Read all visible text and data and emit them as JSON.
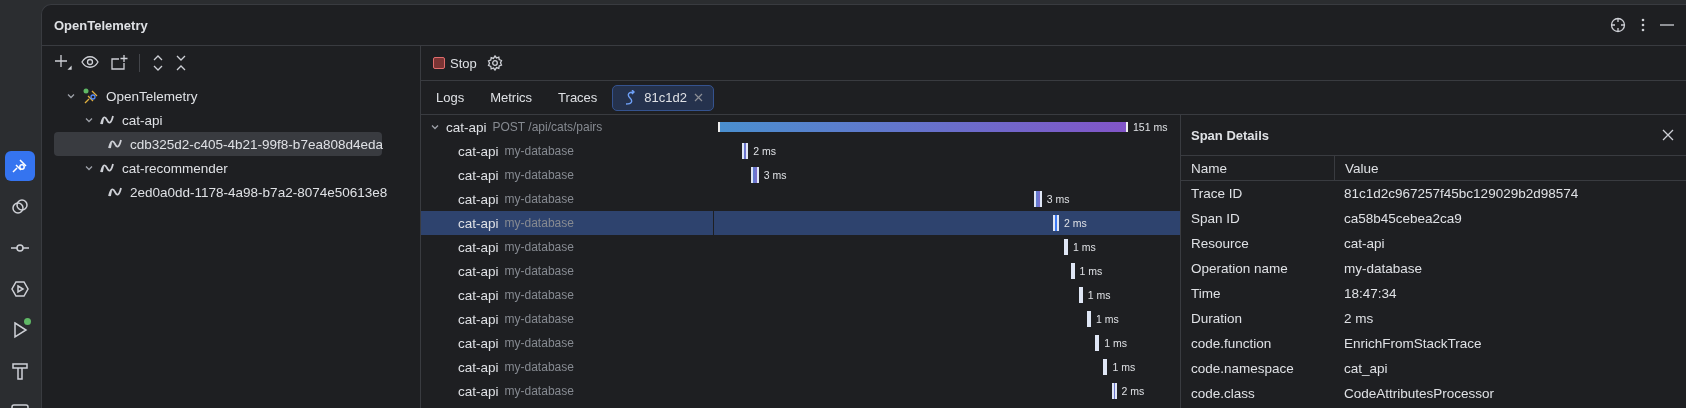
{
  "tool_strip": [
    {
      "kind": "telemetry",
      "selected": true
    },
    {
      "kind": "services",
      "selected": false
    },
    {
      "kind": "commit",
      "selected": false
    },
    {
      "kind": "services-run",
      "selected": false
    },
    {
      "kind": "run",
      "selected": false,
      "badge": true
    },
    {
      "kind": "build",
      "selected": false
    },
    {
      "kind": "terminal",
      "selected": false
    }
  ],
  "window": {
    "title": "OpenTelemetry"
  },
  "tree": [
    {
      "label": "OpenTelemetry",
      "expanded": true,
      "selected": false,
      "children": [
        {
          "label": "cat-api",
          "expanded": true,
          "selected": false,
          "children": [
            {
              "label": "cdb325d2-c405-4b21-99f8-b7ea808d4eda",
              "selected": true
            }
          ]
        },
        {
          "label": "cat-recommender",
          "expanded": true,
          "selected": false,
          "children": [
            {
              "label": "2ed0a0dd-1178-4a98-b7a2-8074e50613e8",
              "selected": false
            }
          ]
        }
      ]
    }
  ],
  "toolbar": {
    "stop_label": "Stop"
  },
  "tabs": [
    {
      "label": "Logs",
      "selected": false,
      "closable": false
    },
    {
      "label": "Metrics",
      "selected": false,
      "closable": false
    },
    {
      "label": "Traces",
      "selected": false,
      "closable": false
    },
    {
      "label": "81c1d2",
      "selected": true,
      "closable": true
    }
  ],
  "spans": [
    {
      "service": "cat-api",
      "operation": "POST /api/cats/pairs",
      "duration": "151 ms",
      "expanded": true,
      "selected": false,
      "children": [
        {
          "service": "cat-api",
          "operation": "my-database",
          "duration": "2 ms",
          "selected": false
        },
        {
          "service": "cat-api",
          "operation": "my-database",
          "duration": "3 ms",
          "selected": false
        },
        {
          "service": "cat-api",
          "operation": "my-database",
          "duration": "3 ms",
          "selected": false
        },
        {
          "service": "cat-api",
          "operation": "my-database",
          "duration": "2 ms",
          "selected": true
        },
        {
          "service": "cat-api",
          "operation": "my-database",
          "duration": "1 ms",
          "selected": false
        },
        {
          "service": "cat-api",
          "operation": "my-database",
          "duration": "1 ms",
          "selected": false
        },
        {
          "service": "cat-api",
          "operation": "my-database",
          "duration": "1 ms",
          "selected": false
        },
        {
          "service": "cat-api",
          "operation": "my-database",
          "duration": "1 ms",
          "selected": false
        },
        {
          "service": "cat-api",
          "operation": "my-database",
          "duration": "1 ms",
          "selected": false
        },
        {
          "service": "cat-api",
          "operation": "my-database",
          "duration": "1 ms",
          "selected": false
        },
        {
          "service": "cat-api",
          "operation": "my-database",
          "duration": "2 ms",
          "selected": false
        }
      ]
    }
  ],
  "span_details": {
    "title": "Span Details",
    "columns": [
      "Name",
      "Value"
    ],
    "rows": [
      [
        "Trace ID",
        "81c1d2c967257f45bc129029b2d98574"
      ],
      [
        "Span ID",
        "ca58b45cebea2ca9"
      ],
      [
        "Resource",
        "cat-api"
      ],
      [
        "Operation name",
        "my-database"
      ],
      [
        "Time",
        "18:47:34"
      ],
      [
        "Duration",
        "2 ms"
      ],
      [
        "code.function",
        "EnrichFromStackTrace"
      ],
      [
        "code.namespace",
        "cat_api"
      ],
      [
        "code.class",
        "CodeAttributesProcessor"
      ]
    ]
  }
}
